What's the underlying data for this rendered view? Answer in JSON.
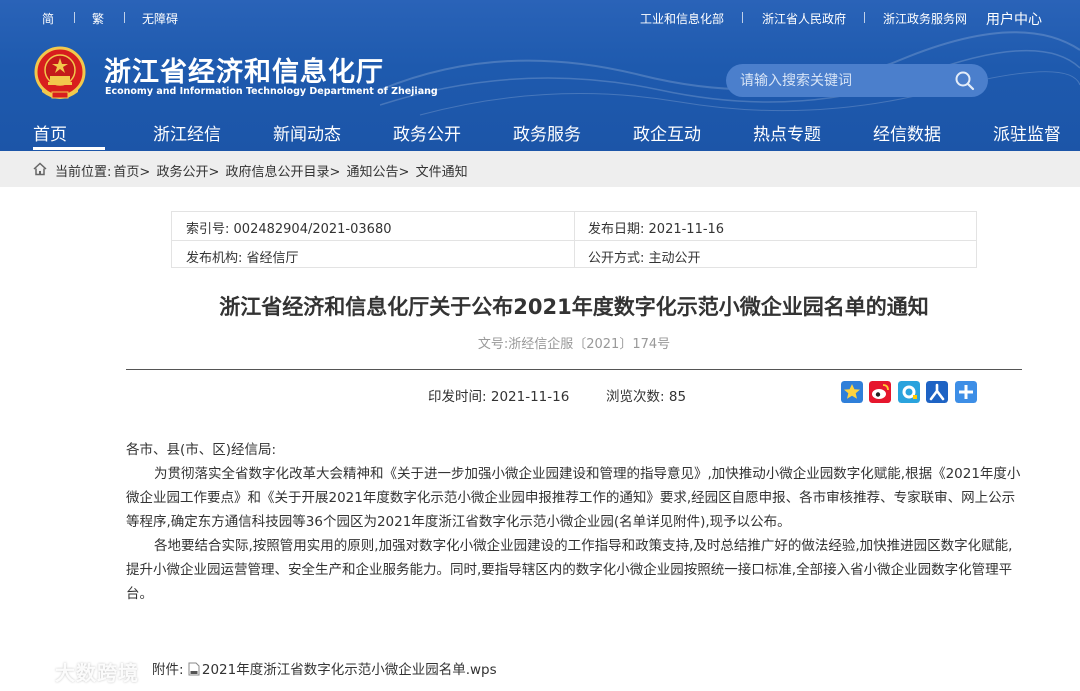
{
  "topbar": {
    "simplified": "简",
    "traditional": "繁",
    "accessibility": "无障碍",
    "links": [
      "工业和信息化部",
      "浙江省人民政府",
      "浙江政务服务网"
    ],
    "user_center": "用户中心"
  },
  "site": {
    "title": "浙江省经济和信息化厅",
    "subtitle": "Economy and Information Technology Department of Zhejiang"
  },
  "search": {
    "placeholder": "请输入搜索关键词"
  },
  "nav": {
    "items": [
      "首页",
      "浙江经信",
      "新闻动态",
      "政务公开",
      "政务服务",
      "政企互动",
      "热点专题",
      "经信数据",
      "派驻监督"
    ],
    "active": "首页"
  },
  "breadcrumb": {
    "label": "当前位置:",
    "items": [
      "首页>",
      "政务公开>",
      "政府信息公开目录>",
      "通知公告>",
      "文件通知"
    ]
  },
  "meta": {
    "index_label": "索引号:",
    "index_value": "002482904/2021-03680",
    "date_label": "发布日期:",
    "date_value": "2021-11-16",
    "org_label": "发布机构:",
    "org_value": "省经信厅",
    "mode_label": "公开方式:",
    "mode_value": "主动公开"
  },
  "document": {
    "title": "浙江省经济和信息化厅关于公布2021年度数字化示范小微企业园名单的通知",
    "number": "文号:浙经信企服〔2021〕174号",
    "print_time_label": "印发时间:",
    "print_time": "2021-11-16",
    "views_label": "浏览次数:",
    "views": "85",
    "salutation": "各市、县(市、区)经信局:",
    "paragraph1": "为贯彻落实全省数字化改革大会精神和《关于进一步加强小微企业园建设和管理的指导意见》,加快推动小微企业园数字化赋能,根据《2021年度小微企业园工作要点》和《关于开展2021年度数字化示范小微企业园申报推荐工作的通知》要求,经园区自愿申报、各市审核推荐、专家联审、网上公示等程序,确定东方通信科技园等36个园区为2021年度浙江省数字化示范小微企业园(名单详见附件),现予以公布。",
    "paragraph2": "各地要结合实际,按照管用实用的原则,加强对数字化小微企业园建设的工作指导和政策支持,及时总结推广好的做法经验,加快推进园区数字化赋能,提升小微企业园运营管理、安全生产和企业服务能力。同时,要指导辖区内的数字化小微企业园按照统一接口标准,全部接入省小微企业园数字化管理平台。",
    "attachment_label": "附件:",
    "attachment_file": "2021年度浙江省数字化示范小微企业园名单.wps"
  },
  "share_icons": [
    "star-icon",
    "weibo-icon",
    "qzone-icon",
    "renren-icon",
    "more-plus-icon"
  ],
  "watermark": "大数跨境",
  "colors": {
    "header_blue": "#1e5aae",
    "search_bg": "#4b7fcc",
    "breadcrumb_bg": "#eeeeee"
  }
}
